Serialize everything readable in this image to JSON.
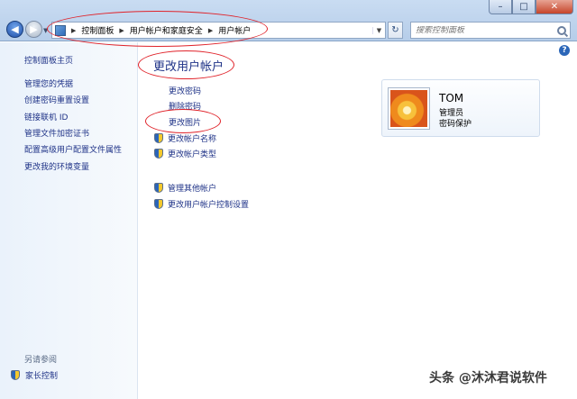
{
  "window": {
    "min_glyph": "–",
    "max_glyph": "□",
    "close_glyph": "✕"
  },
  "address": {
    "crumbs": [
      "控制面板",
      "用户帐户和家庭安全",
      "用户帐户"
    ]
  },
  "search": {
    "placeholder": "搜索控制面板"
  },
  "sidebar": {
    "items": [
      "控制面板主页",
      "管理您的凭据",
      "创建密码重置设置",
      "链接联机 ID",
      "管理文件加密证书",
      "配置高级用户配置文件属性",
      "更改我的环境变量"
    ],
    "see_also_heading": "另请参阅",
    "parental_controls": "家长控制"
  },
  "main": {
    "title": "更改用户帐户",
    "tasks": [
      "更改密码",
      "删除密码",
      "更改图片"
    ],
    "shield_tasks": [
      "更改帐户名称",
      "更改帐户类型"
    ],
    "shield_tasks2": [
      "管理其他帐户",
      "更改用户帐户控制设置"
    ],
    "help": "?"
  },
  "account": {
    "name": "TOM",
    "role": "管理员",
    "password_status": "密码保护"
  },
  "watermark": "头条 @沐沐君说软件",
  "colors": {
    "link": "#1e3287",
    "annotation": "#e0232a"
  }
}
